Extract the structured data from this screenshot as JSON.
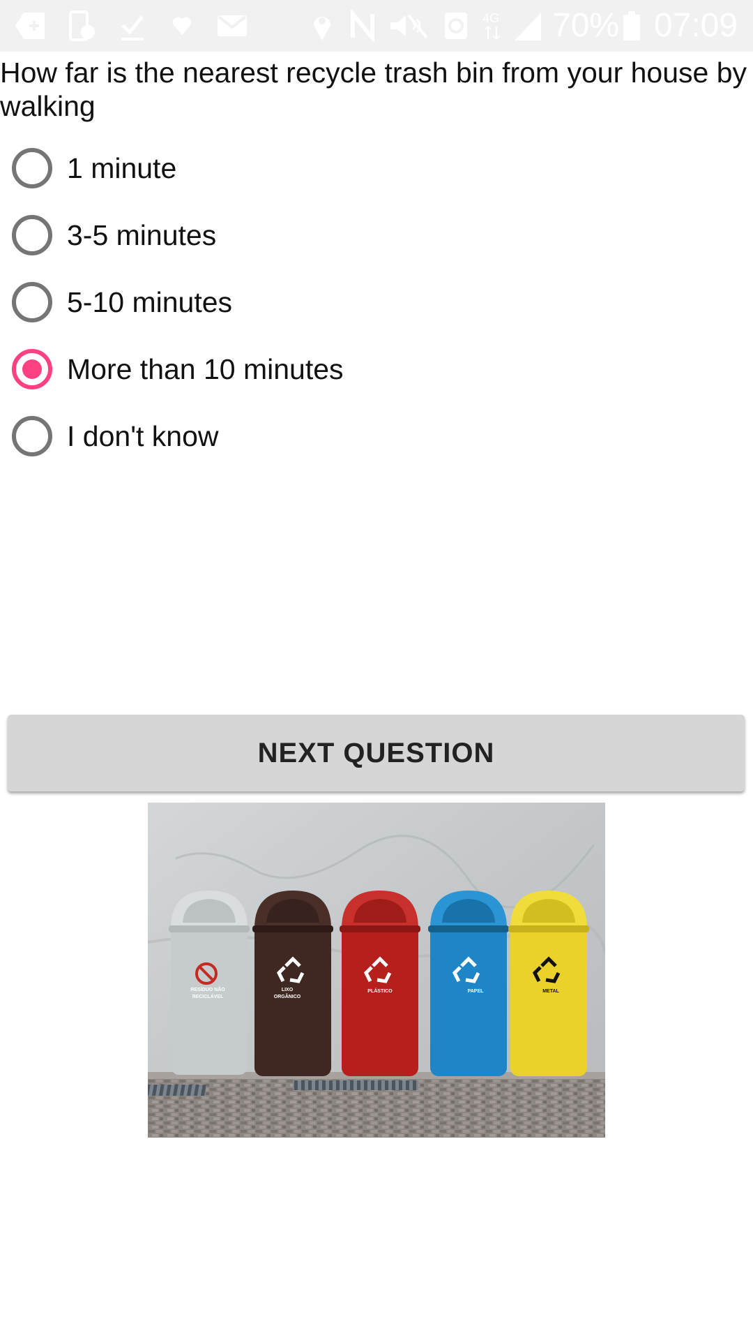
{
  "status_bar": {
    "battery_percent": "70%",
    "time": "07:09",
    "network_type": "4G",
    "icons": [
      "add-box-icon",
      "phone-clock-icon",
      "check-icon",
      "heart-icon",
      "mail-icon",
      "location-icon",
      "nfc-icon",
      "mute-icon",
      "sync-icon",
      "network-4g-icon",
      "signal-icon",
      "battery-icon"
    ]
  },
  "question": {
    "text": "How far is the nearest recycle trash bin from your house by walking"
  },
  "options": [
    {
      "label": "1 minute",
      "checked": false
    },
    {
      "label": "3-5 minutes",
      "checked": false
    },
    {
      "label": "5-10 minutes",
      "checked": false
    },
    {
      "label": "More than 10 minutes",
      "checked": true
    },
    {
      "label": "I don't know",
      "checked": false
    }
  ],
  "button": {
    "label": "NEXT QUESTION"
  },
  "image": {
    "bins": [
      {
        "color": "#c6cbcb",
        "label": "RESÍDUO NÃO RECICLÁVEL",
        "symbol": "no-icon"
      },
      {
        "color": "#3f2722",
        "label": "LIXO ORGÂNICO",
        "symbol": "recycle-icon"
      },
      {
        "color": "#b6201c",
        "label": "PLÁSTICO",
        "symbol": "recycle-icon"
      },
      {
        "color": "#1e86c6",
        "label": "PAPEL",
        "symbol": "recycle-icon"
      },
      {
        "color": "#ead22a",
        "label": "METAL",
        "symbol": "recycle-icon"
      }
    ]
  },
  "colors": {
    "accent": "#ff4081",
    "radio_unchecked": "#757575",
    "button_bg": "#d6d6d6",
    "status_bar_bg": "#f1f1f1"
  }
}
